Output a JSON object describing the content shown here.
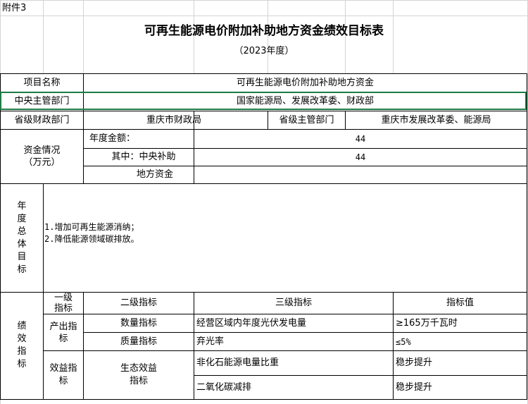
{
  "attachment_label": "附件3",
  "title": "可再生能源电价附加补助地方资金绩效目标表",
  "year": "（2023年度）",
  "rows": {
    "project_name_label": "项目名称",
    "project_name_value": "可再生能源电价附加补助地方资金",
    "central_dept_label": "中央主管部门",
    "central_dept_value": "国家能源局、发展改革委、财政部",
    "prov_finance_label": "省级财政部门",
    "prov_finance_value": "重庆市财政局",
    "prov_dept_label": "省级主管部门",
    "prov_dept_value": "重庆市发展改革委、能源局"
  },
  "funds": {
    "label_line1": "资金情况",
    "label_line2": "（万元）",
    "annual_label": "年度金额：",
    "annual_value": "44",
    "central_label": "其中：中央补助",
    "central_value": "44",
    "local_label": "地方资金",
    "local_value": ""
  },
  "goals": {
    "label_chars": [
      "年",
      "度",
      "总",
      "体",
      "目",
      "标"
    ],
    "line1": "1.增加可再生能源消纳；",
    "line2": "2.降低能源领域碳排放。"
  },
  "indicators": {
    "label_chars": [
      "绩",
      "效",
      "指",
      "标"
    ],
    "header": {
      "level1_line1": "一级",
      "level1_line2": "指标",
      "level2": "二级指标",
      "level3": "三级指标",
      "value": "指标值"
    },
    "output": {
      "level1_line1": "产出指",
      "level1_line2": "标",
      "rows": [
        {
          "level2": "数量指标",
          "level3": "经营区域内年度光伏发电量",
          "value": "≥165万千瓦时"
        },
        {
          "level2": "质量指标",
          "level3": "弃光率",
          "value": "≤5%"
        }
      ]
    },
    "benefit": {
      "level1_line1": "效益指",
      "level1_line2": "标",
      "level2_line1": "生态效益",
      "level2_line2": "指标",
      "rows": [
        {
          "level3": "非化石能源电量比重",
          "value": "稳步提升"
        },
        {
          "level3": "二氧化碳减排",
          "value": "稳步提升"
        }
      ]
    }
  }
}
